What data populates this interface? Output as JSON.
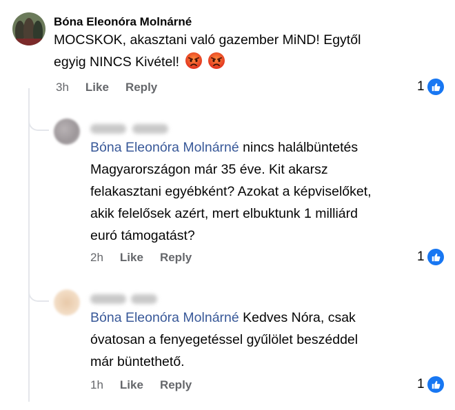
{
  "comments": [
    {
      "author": "Bóna Eleonóra Molnárné",
      "lines": [
        "MOCSKOK, akasztani való gazember MiND! Egytől",
        "egyig NINCS Kivétel!"
      ],
      "emoji": [
        "angry-face-emoji",
        "angry-face-emoji"
      ],
      "time": "3h",
      "like_label": "Like",
      "reply_label": "Reply",
      "reaction_count": "1"
    },
    {
      "mention": "Bóna Eleonóra Molnárné",
      "lines": [
        " nincs halálbüntetés",
        "Magyarországon már 35 éve. Kit akarsz",
        "felakasztani egyébként? Azokat a képviselőket,",
        "akik felelősek azért, mert elbuktunk 1 milliárd",
        "euró támogatást?"
      ],
      "time": "2h",
      "like_label": "Like",
      "reply_label": "Reply",
      "reaction_count": "1"
    },
    {
      "mention": "Bóna Eleonóra Molnárné",
      "lines": [
        " Kedves  Nóra, csak",
        "óvatosan a fenyegetéssel gyűlölet beszéddel",
        "már büntethető."
      ],
      "time": "1h",
      "like_label": "Like",
      "reply_label": "Reply",
      "reaction_count": "1"
    }
  ],
  "icons": {
    "reaction": "like-thumb-icon",
    "emoji": "angry-face-emoji"
  },
  "colors": {
    "mention": "#385898",
    "like": "#1877f2",
    "meta": "#65676b"
  }
}
